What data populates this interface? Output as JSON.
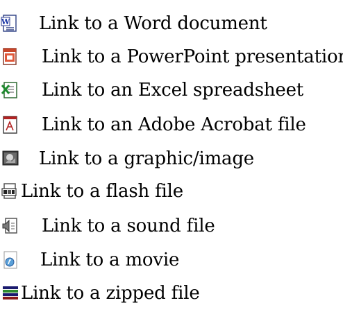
{
  "links": [
    {
      "label": "Link to a Word document",
      "icon": "word-document-icon"
    },
    {
      "label": "Link to a PowerPoint presentation",
      "icon": "powerpoint-icon"
    },
    {
      "label": "Link to an Excel spreadsheet",
      "icon": "excel-icon"
    },
    {
      "label": "Link to an Adobe Acrobat file",
      "icon": "acrobat-pdf-icon"
    },
    {
      "label": "Link to a graphic/image",
      "icon": "image-icon"
    },
    {
      "label": "Link to a flash file",
      "icon": "flash-file-icon"
    },
    {
      "label": "Link to a sound file",
      "icon": "sound-file-icon"
    },
    {
      "label": "Link to a movie",
      "icon": "movie-icon"
    },
    {
      "label": "Link to a zipped file",
      "icon": "zipped-file-icon"
    }
  ]
}
